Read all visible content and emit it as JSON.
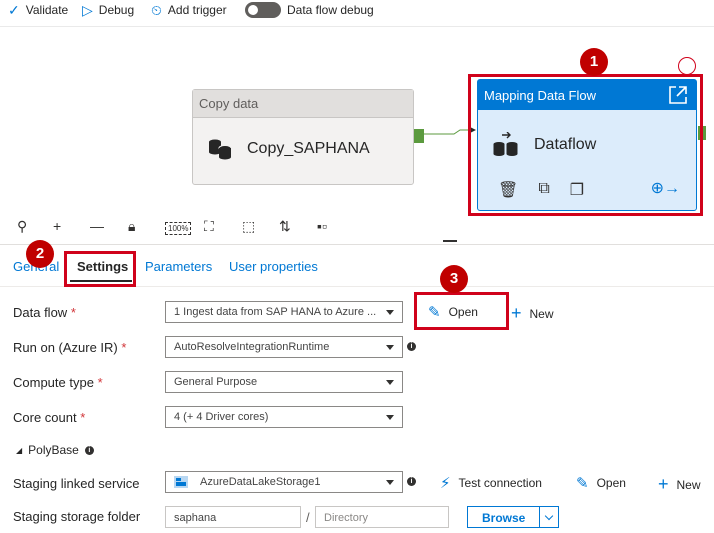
{
  "toolbar": {
    "validate": "Validate",
    "debug": "Debug",
    "add_trigger": "Add trigger",
    "data_flow_debug": "Data flow debug"
  },
  "canvas": {
    "copy_activity": {
      "type_label": "Copy data",
      "name": "Copy_SAPHANA"
    },
    "dataflow_activity": {
      "type_label": "Mapping Data Flow",
      "name": "Dataflow"
    }
  },
  "callouts": [
    "1",
    "2",
    "3"
  ],
  "tabs": [
    {
      "label": "General"
    },
    {
      "label": "Settings",
      "active": true
    },
    {
      "label": "Parameters"
    },
    {
      "label": "User properties"
    }
  ],
  "form": {
    "data_flow": {
      "label": "Data flow",
      "value": "1 Ingest data from SAP HANA to Azure ...",
      "open": "Open",
      "new": "New"
    },
    "run_on": {
      "label": "Run on (Azure IR)",
      "value": "AutoResolveIntegrationRuntime"
    },
    "compute_type": {
      "label": "Compute type",
      "value": "General Purpose"
    },
    "core_count": {
      "label": "Core count",
      "value": "4 (+ 4 Driver cores)"
    },
    "polybase": {
      "label": "PolyBase"
    },
    "staging_linked_service": {
      "label": "Staging linked service",
      "value": "AzureDataLakeStorage1",
      "test_connection": "Test connection",
      "open": "Open",
      "new": "New"
    },
    "staging_storage_folder": {
      "label": "Staging storage folder",
      "container": "saphana",
      "separator": "/",
      "directory_placeholder": "Directory",
      "browse": "Browse"
    }
  },
  "colors": {
    "accent": "#0078d4",
    "callout": "#c00000",
    "port": "#5b9a3e"
  }
}
